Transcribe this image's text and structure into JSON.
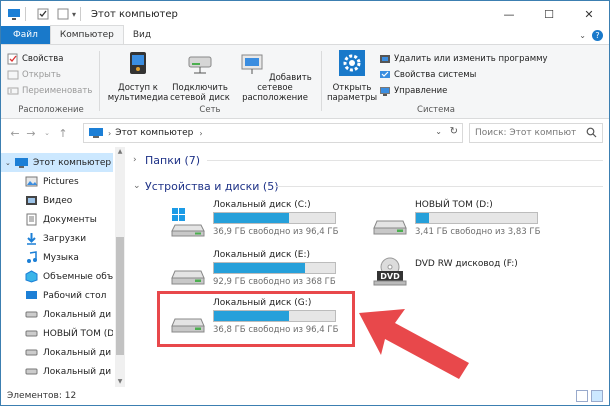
{
  "window": {
    "title": "Этот компьютер",
    "minimize": "—",
    "maximize": "☐",
    "close": "✕"
  },
  "tabs": [
    {
      "label": "Файл"
    },
    {
      "label": "Компьютер"
    },
    {
      "label": "Вид"
    }
  ],
  "ribbon": {
    "location": {
      "label": "Расположение",
      "properties": "Свойства",
      "open": "Открыть",
      "rename": "Переименовать"
    },
    "network": {
      "label": "Сеть",
      "media": "Доступ к\nмультимедиа",
      "map_drive": "Подключить\nсетевой диск",
      "add_location": "Добавить сетевое\nрасположение"
    },
    "system": {
      "label": "Система",
      "open_settings": "Открыть\nпараметры",
      "uninstall": "Удалить или изменить программу",
      "system_properties": "Свойства системы",
      "manage": "Управление"
    }
  },
  "address": {
    "crumb": "Этот компьютер",
    "search_placeholder": "Поиск: Этот компьют"
  },
  "navpane": {
    "items": [
      {
        "label": "Этот компьютер",
        "icon": "computer-icon",
        "selected": true
      },
      {
        "label": "Pictures",
        "icon": "pictures-icon"
      },
      {
        "label": "Видео",
        "icon": "video-icon"
      },
      {
        "label": "Документы",
        "icon": "documents-icon"
      },
      {
        "label": "Загрузки",
        "icon": "downloads-icon"
      },
      {
        "label": "Музыка",
        "icon": "music-icon"
      },
      {
        "label": "Объемные объ",
        "icon": "3d-objects-icon"
      },
      {
        "label": "Рабочий стол",
        "icon": "desktop-icon"
      },
      {
        "label": "Локальный ди",
        "icon": "drive-icon"
      },
      {
        "label": "НОВЫЙ ТОМ (D",
        "icon": "drive-icon"
      },
      {
        "label": "Локальный ди",
        "icon": "drive-icon"
      },
      {
        "label": "Локальный ди",
        "icon": "drive-icon"
      }
    ]
  },
  "content": {
    "folders_header": "Папки (7)",
    "devices_header": "Устройства и диски (5)",
    "drives": [
      {
        "name": "Локальный диск (C:)",
        "free": "36,9 ГБ свободно из 96,4 ГБ",
        "used_fraction": 0.62,
        "type": "system"
      },
      {
        "name": "НОВЫЙ ТОМ (D:)",
        "free": "3,41 ГБ свободно из 3,83 ГБ",
        "used_fraction": 0.11,
        "type": "hdd"
      },
      {
        "name": "Локальный диск (E:)",
        "free": "92,9 ГБ свободно из 368 ГБ",
        "used_fraction": 0.75,
        "type": "hdd"
      },
      {
        "name": "DVD RW дисковод (F:)",
        "free": "",
        "type": "dvd"
      },
      {
        "name": "Локальный диск (G:)",
        "free": "36,8 ГБ свободно из 96,4 ГБ",
        "used_fraction": 0.62,
        "type": "hdd"
      }
    ]
  },
  "status": {
    "items_count": "Элементов: 12"
  },
  "colors": {
    "accent": "#1979ca",
    "bar_fill": "#26a0da",
    "highlight": "#e8484b",
    "arrow": "#e8484b"
  }
}
